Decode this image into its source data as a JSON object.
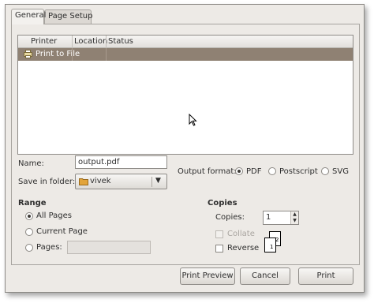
{
  "tabs": {
    "general": "General",
    "page_setup": "Page Setup"
  },
  "printer_list": {
    "columns": [
      "Printer",
      "Location",
      "Status"
    ],
    "rows": [
      {
        "printer": "Print to File",
        "location": "",
        "status": "",
        "selected": true,
        "icon": "printer-file-icon"
      }
    ]
  },
  "file": {
    "name_label": "Name:",
    "name_value": "output.pdf",
    "folder_label": "Save in folder:",
    "folder_value": "vivek",
    "format_label": "Output format:",
    "formats": [
      {
        "label": "PDF",
        "selected": true
      },
      {
        "label": "Postscript",
        "selected": false
      },
      {
        "label": "SVG",
        "selected": false
      }
    ]
  },
  "range": {
    "heading": "Range",
    "all_pages": "All Pages",
    "current_page": "Current Page",
    "pages": "Pages:",
    "pages_value": "",
    "selected": "All Pages"
  },
  "copies": {
    "heading": "Copies",
    "copies_label": "Copies:",
    "copies_value": "1",
    "collate": "Collate",
    "collate_checked": false,
    "collate_enabled": false,
    "reverse": "Reverse",
    "reverse_checked": false
  },
  "buttons": {
    "preview": "Print Preview",
    "cancel": "Cancel",
    "print": "Print"
  },
  "colors": {
    "dialog_bg": "#edeae6",
    "selection": "#8f8173"
  }
}
